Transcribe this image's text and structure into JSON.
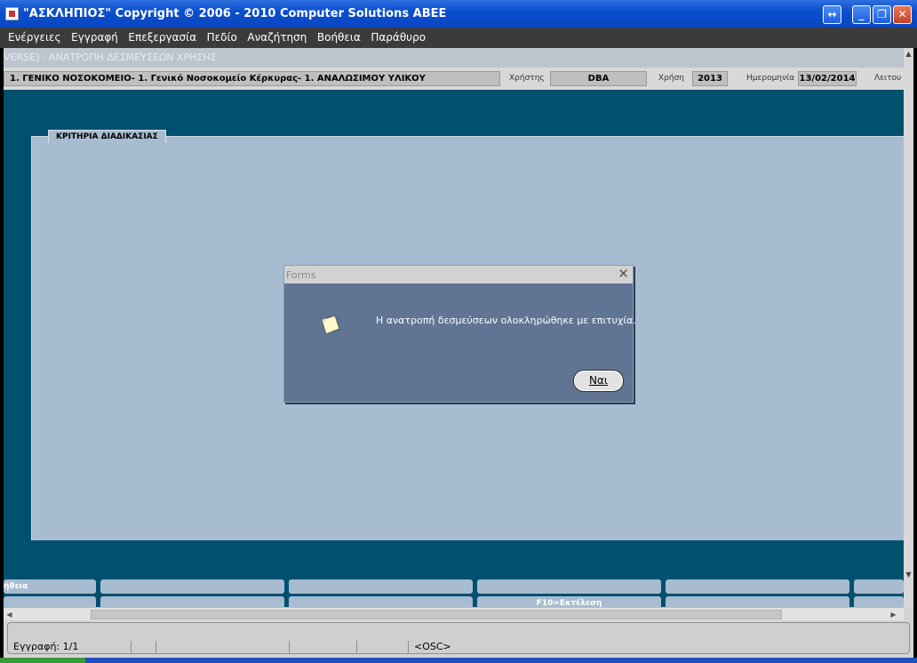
{
  "window": {
    "title": "\"ΑΣΚΛΗΠΙΟΣ\" Copyright © 2006 - 2010 Computer Solutions ΑΒΕΕ",
    "buttons": {
      "resize": "↔",
      "minimize": "_",
      "restore": "❐",
      "close": "✕"
    }
  },
  "menu": [
    "Ενέργειες",
    "Εγγραφή",
    "Επεξεργασία",
    "Πεδίο",
    "Αναζήτηση",
    "Βοήθεια",
    "Παράθυρο"
  ],
  "form": {
    "status_title": "VERSE]  :  ΑΝΑΤΡΟΠΗ ΔΕΣΜΕΥΣΕΩΝ ΧΡΗΣΗΣ",
    "org": "1. ΓΕΝΙΚΟ ΝΟΣΟΚΟΜΕΙΟ- 1. Γενικό Νοσοκομείο Κέρκυρας- 1. ΑΝΑΛΩΣΙΜΟΥ ΥΛΙΚΟΥ",
    "user_label": "Χρήστης",
    "user_value": "DBA",
    "year_label": "Χρήση",
    "year_value": "2013",
    "date_label": "Ημερομηνία",
    "date_value": "13/02/2014",
    "mode_label": "Λειτου",
    "criteria_tab": "ΚΡΙΤΗΡΙΑ ΔΙΑΔΙΚΑΣΙΑΣ"
  },
  "fkeys": {
    "row1_first": "ήθεια",
    "row2_f10": "F10=Εκτέλεση"
  },
  "status": {
    "record": "Εγγραφή: 1/1",
    "osc": "<OSC>"
  },
  "dialog": {
    "title": "Forms",
    "message": "Η ανατροπή δεσμεύσεων ολοκληρώθηκε με επιτυχία.",
    "ok_button": "Ναι",
    "icon": "note-icon"
  },
  "colors": {
    "titlebar": "#0b4fcf",
    "main_bg": "#00506e",
    "panel_bg": "#a8bcd1",
    "dialog_bg": "#607594"
  }
}
